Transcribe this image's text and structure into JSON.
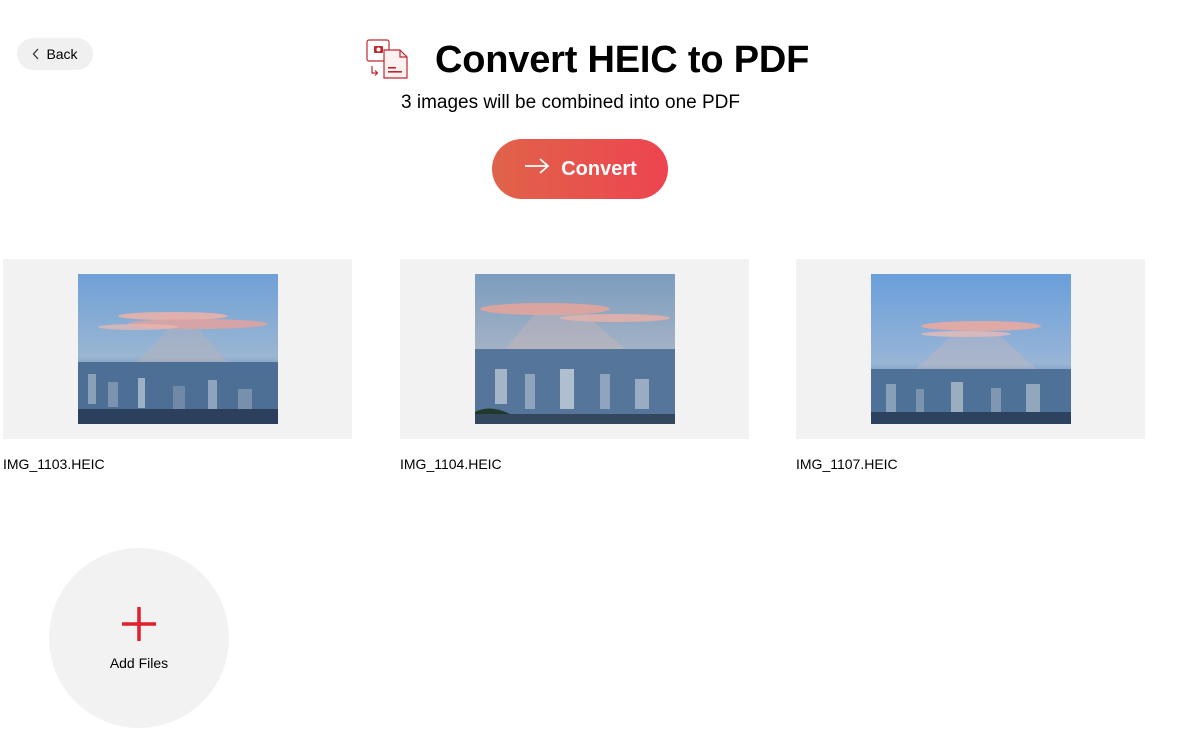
{
  "back_button": {
    "label": "Back",
    "icon": "chevron-left-icon"
  },
  "header": {
    "icon": "heic-to-pdf-icon",
    "title": "Convert HEIC to PDF",
    "subtitle": "3 images will be combined into one PDF"
  },
  "convert_button": {
    "label": "Convert",
    "icon": "arrow-right-icon"
  },
  "files": [
    {
      "name": "IMG_1103.HEIC"
    },
    {
      "name": "IMG_1104.HEIC"
    },
    {
      "name": "IMG_1107.HEIC"
    }
  ],
  "add_files": {
    "label": "Add Files",
    "icon": "plus-icon"
  },
  "colors": {
    "accent_start": "#e0634a",
    "accent_end": "#ee4450",
    "plus": "#e0202e",
    "surface": "#f2f2f2"
  }
}
